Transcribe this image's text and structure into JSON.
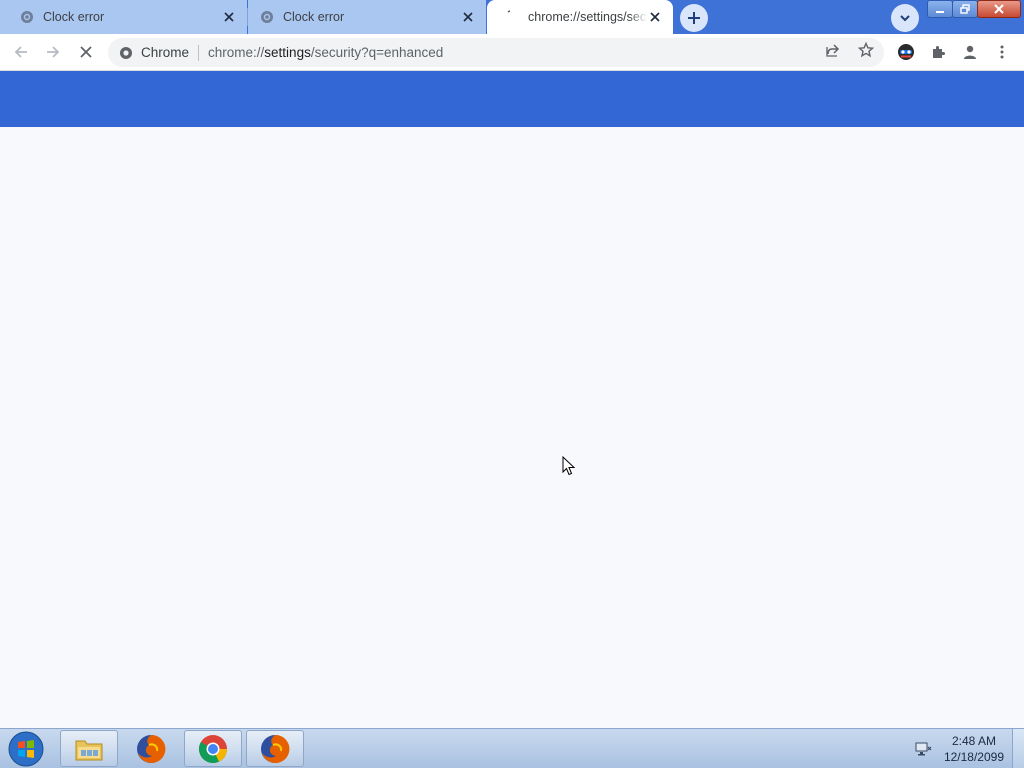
{
  "tabs": [
    {
      "title": "Clock error",
      "state": "inactive",
      "icon": "globe-icon"
    },
    {
      "title": "Clock error",
      "state": "inactive",
      "icon": "globe-icon"
    },
    {
      "title": "chrome://settings/security",
      "state": "active",
      "icon": "loading-icon"
    }
  ],
  "toolbar": {
    "chip_label": "Chrome",
    "url_prefix": "chrome://",
    "url_host": "settings",
    "url_rest": "/security?q=enhanced"
  },
  "taskbar": {
    "time": "2:48 AM",
    "date": "12/18/2099",
    "apps": [
      "windows-explorer",
      "firefox",
      "chrome",
      "firefox"
    ]
  },
  "colors": {
    "tabstrip": "#3f72d6",
    "page_header": "#3367d6",
    "page_body": "#f7f9fd"
  }
}
